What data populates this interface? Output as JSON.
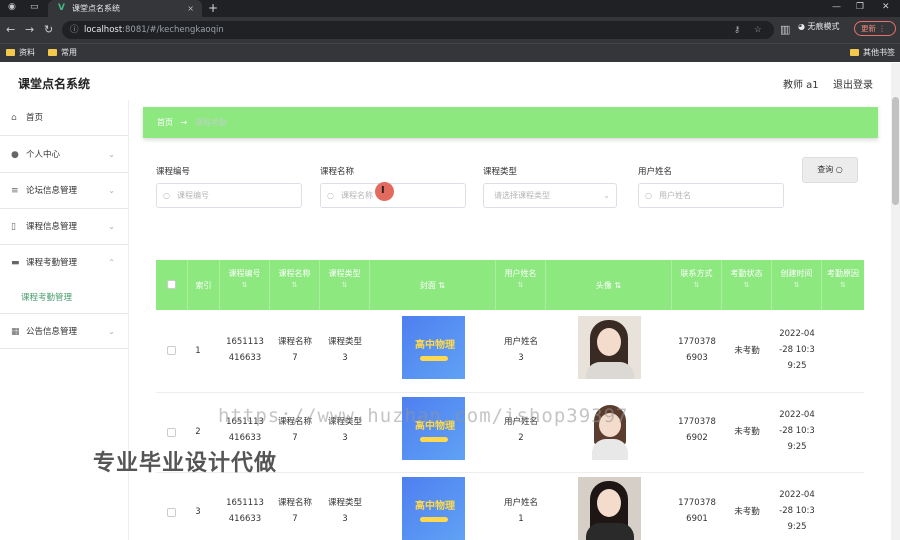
{
  "browser": {
    "tab_title": "课堂点名系统",
    "url_host": "localhost",
    "url_path": ":8081/#/kechengkaoqin",
    "incognito_label": "无痕模式",
    "update_label": "更新",
    "bookmarks": [
      "资料",
      "常用"
    ],
    "other_bookmarks": "其他书签"
  },
  "app": {
    "title": "课堂点名系统",
    "user": "教师 a1",
    "logout": "退出登录"
  },
  "sidebar": {
    "items": [
      {
        "label": "首页",
        "icon": "home-icon"
      },
      {
        "label": "个人中心",
        "icon": "user-icon"
      },
      {
        "label": "论坛信息管理",
        "icon": "list-icon"
      },
      {
        "label": "课程信息管理",
        "icon": "book-icon"
      },
      {
        "label": "课程考勤管理",
        "icon": "folder-icon"
      },
      {
        "label": "公告信息管理",
        "icon": "grid-icon"
      }
    ],
    "sub_item": "课程考勤管理"
  },
  "breadcrumb": {
    "home": "首页",
    "arrow": "→",
    "current": "课程考勤"
  },
  "filters": {
    "course_no_label": "课程编号",
    "course_no_placeholder": "课程编号",
    "course_name_label": "课程名称",
    "course_name_placeholder": "课程名称",
    "course_type_label": "课程类型",
    "course_type_placeholder": "请选择课程类型",
    "user_name_label": "用户姓名",
    "user_name_placeholder": "用户姓名",
    "query_label": "查询"
  },
  "table": {
    "columns": [
      "索引",
      "课程编号",
      "课程名称",
      "课程类型",
      "封面",
      "用户姓名",
      "头像",
      "联系方式",
      "考勤状态",
      "创建时间",
      "考勤原因"
    ],
    "cover_text": "高中物理",
    "rows": [
      {
        "index": "1",
        "course_no": [
          "1651113",
          "416633"
        ],
        "course_name": [
          "课程名称",
          "7"
        ],
        "course_type": [
          "课程类型",
          "3"
        ],
        "user_name": [
          "用户姓名",
          "3"
        ],
        "phone": [
          "1770378",
          "6903"
        ],
        "status": "未考勤",
        "time": [
          "2022-04",
          "-28 10:3",
          "9:25"
        ]
      },
      {
        "index": "2",
        "course_no": [
          "1651113",
          "416633"
        ],
        "course_name": [
          "课程名称",
          "7"
        ],
        "course_type": [
          "课程类型",
          "3"
        ],
        "user_name": [
          "用户姓名",
          "2"
        ],
        "phone": [
          "1770378",
          "6902"
        ],
        "status": "未考勤",
        "time": [
          "2022-04",
          "-28 10:3",
          "9:25"
        ]
      },
      {
        "index": "3",
        "course_no": [
          "1651113",
          "416633"
        ],
        "course_name": [
          "课程名称",
          "7"
        ],
        "course_type": [
          "课程类型",
          "3"
        ],
        "user_name": [
          "用户姓名",
          "1"
        ],
        "phone": [
          "1770378",
          "6901"
        ],
        "status": "未考勤",
        "time": [
          "2022-04",
          "-28 10:3",
          "9:25"
        ]
      }
    ]
  },
  "watermark": {
    "url": "https://www.huzhan.com/ishop39397",
    "caption": "专业毕业设计代做"
  }
}
